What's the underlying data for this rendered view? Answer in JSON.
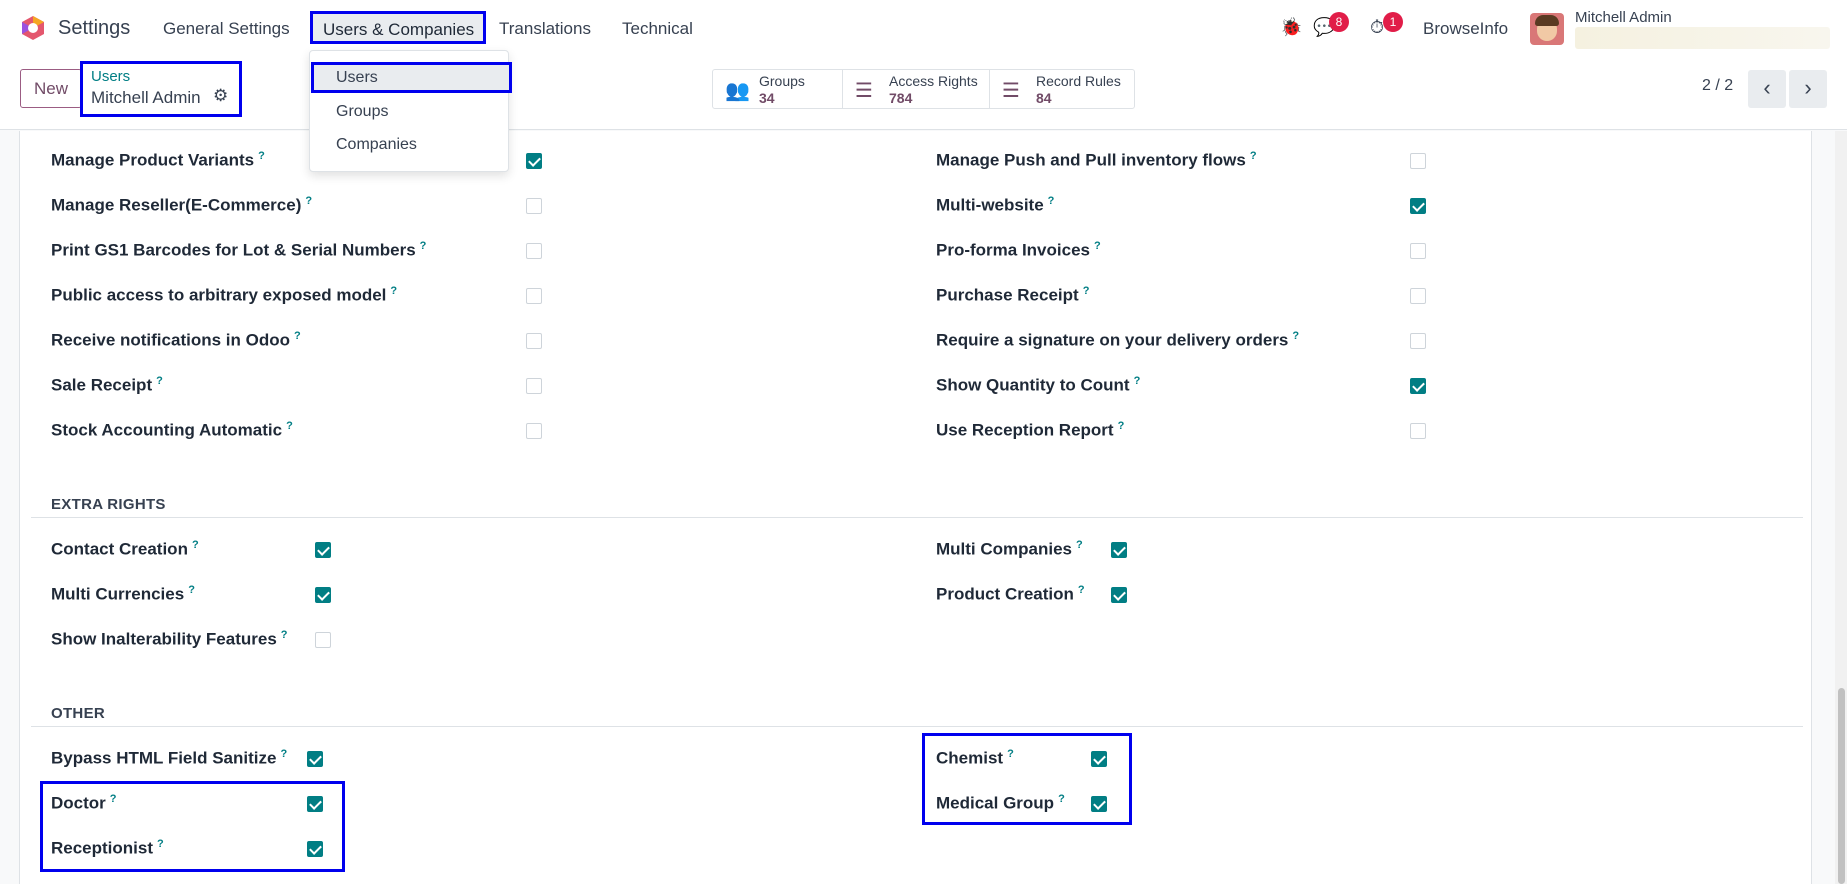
{
  "topbar": {
    "app_name": "Settings",
    "menu": [
      "General Settings",
      "Users & Companies",
      "Translations",
      "Technical"
    ],
    "active_menu": "Users & Companies",
    "messages_badge": "8",
    "activities_badge": "1",
    "company": "BrowseInfo",
    "user": "Mitchell Admin"
  },
  "dropdown": {
    "items": [
      "Users",
      "Groups",
      "Companies"
    ],
    "active": "Users"
  },
  "control": {
    "new_label": "New",
    "breadcrumb_parent": "Users",
    "breadcrumb_current": "Mitchell Admin",
    "smart_buttons": [
      {
        "label": "Groups",
        "count": "34",
        "icon": "users-icon"
      },
      {
        "label": "Access Rights",
        "count": "784",
        "icon": "list-icon"
      },
      {
        "label": "Record Rules",
        "count": "84",
        "icon": "list-icon"
      }
    ],
    "pager": "2 / 2"
  },
  "technical_rows": [
    {
      "left": "Manage Product Variants",
      "left_checked": true,
      "right": "Manage Push and Pull inventory flows",
      "right_checked": false
    },
    {
      "left": "Manage Reseller(E-Commerce)",
      "left_checked": false,
      "right": "Multi-website",
      "right_checked": true
    },
    {
      "left": "Print GS1 Barcodes for Lot & Serial Numbers",
      "left_checked": false,
      "right": "Pro-forma Invoices",
      "right_checked": false
    },
    {
      "left": "Public access to arbitrary exposed model",
      "left_checked": false,
      "right": "Purchase Receipt",
      "right_checked": false
    },
    {
      "left": "Receive notifications in Odoo",
      "left_checked": false,
      "right": "Require a signature on your delivery orders",
      "right_checked": false
    },
    {
      "left": "Sale Receipt",
      "left_checked": false,
      "right": "Show Quantity to Count",
      "right_checked": true
    },
    {
      "left": "Stock Accounting Automatic",
      "left_checked": false,
      "right": "Use Reception Report",
      "right_checked": false
    }
  ],
  "extra_rights": {
    "title": "EXTRA RIGHTS",
    "rows": [
      {
        "left": "Contact Creation",
        "left_checked": true,
        "right": "Multi Companies",
        "right_checked": true
      },
      {
        "left": "Multi Currencies",
        "left_checked": true,
        "right": "Product Creation",
        "right_checked": true
      },
      {
        "left": "Show Inalterability Features",
        "left_checked": false
      }
    ]
  },
  "other": {
    "title": "OTHER",
    "rows": [
      {
        "left": "Bypass HTML Field Sanitize",
        "left_checked": true,
        "right": "Chemist",
        "right_checked": true
      },
      {
        "left": "Doctor",
        "left_checked": true,
        "right": "Medical Group",
        "right_checked": true
      },
      {
        "left": "Receptionist",
        "left_checked": true
      }
    ]
  },
  "help_mark": "?",
  "colors": {
    "accent": "#017e84",
    "brand": "#714b67",
    "highlight": "#0000ee"
  }
}
